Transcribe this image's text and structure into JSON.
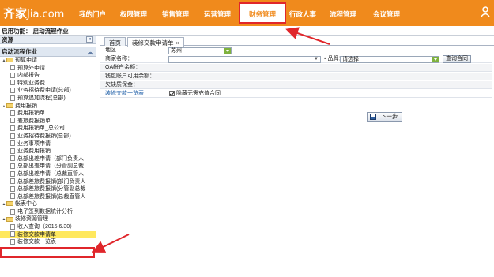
{
  "header": {
    "logo_main": "齐家",
    "logo_sub": "Jia.com",
    "nav": [
      {
        "label": "我的门户"
      },
      {
        "label": "权限管理"
      },
      {
        "label": "销售管理"
      },
      {
        "label": "运营管理"
      },
      {
        "label": "财务管理"
      },
      {
        "label": "行政人事"
      },
      {
        "label": "流程管理"
      },
      {
        "label": "会议管理"
      }
    ],
    "active_nav": "财务管理",
    "user_icon": "user-icon"
  },
  "subbar": {
    "label": "启用功能：  启动流程作业"
  },
  "sidebar": {
    "head1": "资源",
    "head1_btn": "«",
    "head2": "启动流程作业",
    "head2_btn": "«",
    "tree": [
      {
        "label": "预算申请",
        "type": "folder",
        "level": 0
      },
      {
        "label": "预算外申请",
        "type": "doc",
        "level": 1
      },
      {
        "label": "内部报告",
        "type": "doc",
        "level": 1
      },
      {
        "label": "特别业务费",
        "type": "doc",
        "level": 1
      },
      {
        "label": "业务招待费申请(总部)",
        "type": "doc",
        "level": 1
      },
      {
        "label": "预算追加流程(总部)",
        "type": "doc",
        "level": 1
      },
      {
        "label": "费用报销",
        "type": "folder",
        "level": 0
      },
      {
        "label": "费用报销单",
        "type": "doc",
        "level": 1
      },
      {
        "label": "差旅费报销单",
        "type": "doc",
        "level": 1
      },
      {
        "label": "费用报销单_总公司",
        "type": "doc",
        "level": 1
      },
      {
        "label": "业务招待费报销(总部)",
        "type": "doc",
        "level": 1
      },
      {
        "label": "业务事项申请",
        "type": "doc",
        "level": 1
      },
      {
        "label": "业务费用报销",
        "type": "doc",
        "level": 1
      },
      {
        "label": "总部出差申请（部门负责人",
        "type": "doc",
        "level": 1
      },
      {
        "label": "总部出差申请（分管副总裁",
        "type": "doc",
        "level": 1
      },
      {
        "label": "总部出差申请（总裁直管人",
        "type": "doc",
        "level": 1
      },
      {
        "label": "总部差旅费报销(部门负责人",
        "type": "doc",
        "level": 1
      },
      {
        "label": "总部差旅费报销(分管副总裁",
        "type": "doc",
        "level": 1
      },
      {
        "label": "总部差旅费报销(总裁直管人",
        "type": "doc",
        "level": 1
      },
      {
        "label": "帐表中心",
        "type": "folder",
        "level": 0
      },
      {
        "label": "电子签到数据统计分析",
        "type": "doc",
        "level": 1
      },
      {
        "label": "装修资源管理",
        "type": "folder",
        "level": 0
      },
      {
        "label": "收入查询（2015.6.30）",
        "type": "doc",
        "level": 1
      },
      {
        "label": "装修交款申请单",
        "type": "doc",
        "level": 1
      },
      {
        "label": "装修交款一览表",
        "type": "doc",
        "level": 1
      }
    ],
    "selected": "装修交款申请单"
  },
  "tabs": [
    {
      "label": "首页"
    },
    {
      "label": "装修交款申请单",
      "close": "×"
    }
  ],
  "form": {
    "region_label": "地区",
    "region_value": "苏州",
    "merchant_label": "商家名称：",
    "merchant_value": "",
    "brand_label": "品牌：",
    "brand_value": "请选择",
    "query_button": "查询合同",
    "oa_balance_label": "OA帐户余额：",
    "wallet_balance_label": "钱包账户可用余额：",
    "deficit_label": "欠缺质保金：",
    "list_link": "装修交款一览表",
    "hide_label": "隐藏无需充值合同",
    "hide_checked": true,
    "next_button": "下一步"
  },
  "colors": {
    "brand_orange": "#f08a1c",
    "highlight_red": "#e0262b",
    "selected_yellow": "#ffe85e",
    "dropdown_green": "#7fb23d"
  }
}
